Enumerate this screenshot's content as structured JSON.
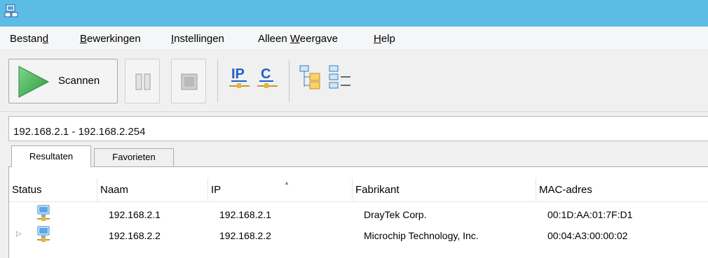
{
  "menu": {
    "items": [
      {
        "pre": "Bestan",
        "u": "d",
        "post": ""
      },
      {
        "pre": "",
        "u": "B",
        "post": "ewerkingen"
      },
      {
        "pre": "",
        "u": "I",
        "post": "nstellingen"
      },
      {
        "pre": "Alleen ",
        "u": "W",
        "post": "eergave"
      },
      {
        "pre": "",
        "u": "H",
        "post": "elp"
      }
    ]
  },
  "toolbar": {
    "scan_label": "Scannen"
  },
  "range": {
    "value": "192.168.2.1 - 192.168.2.254"
  },
  "tabs": {
    "results": "Resultaten",
    "favorites": "Favorieten"
  },
  "table": {
    "columns": [
      "Status",
      "Naam",
      "IP",
      "Fabrikant",
      "MAC-adres"
    ],
    "rows": [
      {
        "naam": "192.168.2.1",
        "ip": "192.168.2.1",
        "fabrikant": "DrayTek Corp.",
        "mac": "00:1D:AA:01:7F:D1",
        "expandable": false
      },
      {
        "naam": "192.168.2.2",
        "ip": "192.168.2.2",
        "fabrikant": "Microchip Technology, Inc.",
        "mac": "00:04:A3:00:00:02",
        "expandable": true
      }
    ]
  },
  "colors": {
    "titlebar": "#5bbde4",
    "play": "#3aa64a"
  },
  "icons": [
    "app-network-icon",
    "play-icon",
    "pause-icon",
    "stop-icon",
    "ip-icon",
    "c-icon",
    "tree-expand-icon",
    "tree-collapse-icon",
    "computer-icon",
    "expand-arrow-icon"
  ]
}
